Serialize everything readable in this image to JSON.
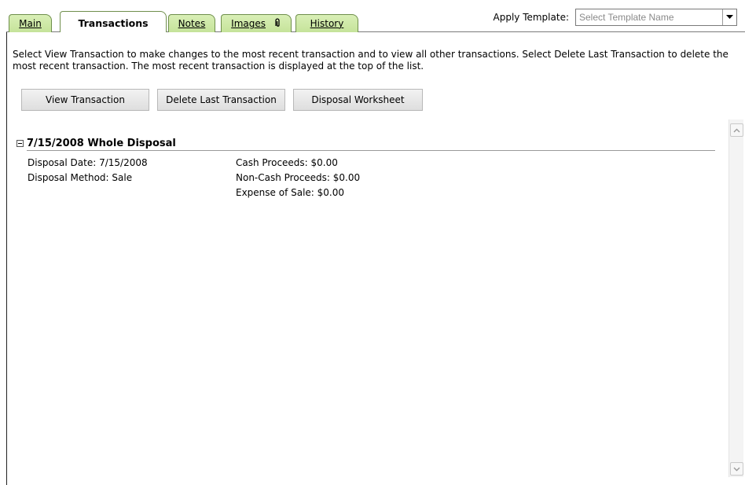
{
  "tabs": [
    {
      "label": "Main",
      "active": false
    },
    {
      "label": "Transactions",
      "active": true
    },
    {
      "label": "Notes",
      "active": false
    },
    {
      "label": "Images",
      "active": false,
      "icon": "paperclip-icon"
    },
    {
      "label": "History",
      "active": false
    }
  ],
  "template": {
    "label": "Apply Template:",
    "placeholder": "Select Template Name"
  },
  "instructions": "Select View Transaction to make changes to the most recent transaction and to view all other transactions. Select Delete Last Transaction to delete the most recent transaction. The most recent transaction is displayed at the top of the list.",
  "buttons": {
    "view": "View Transaction",
    "delete": "Delete Last Transaction",
    "worksheet": "Disposal Worksheet"
  },
  "transaction": {
    "title": "7/15/2008 Whole Disposal",
    "disposal_date": "Disposal Date: 7/15/2008",
    "disposal_method": "Disposal Method: Sale",
    "cash_proceeds": "Cash Proceeds: $0.00",
    "non_cash_proceeds": "Non-Cash Proceeds: $0.00",
    "expense_of_sale": "Expense of Sale: $0.00"
  },
  "colors": {
    "tab_green": "#c5e39a",
    "tab_border": "#6f8f4c",
    "button_gray": "#dedede"
  }
}
